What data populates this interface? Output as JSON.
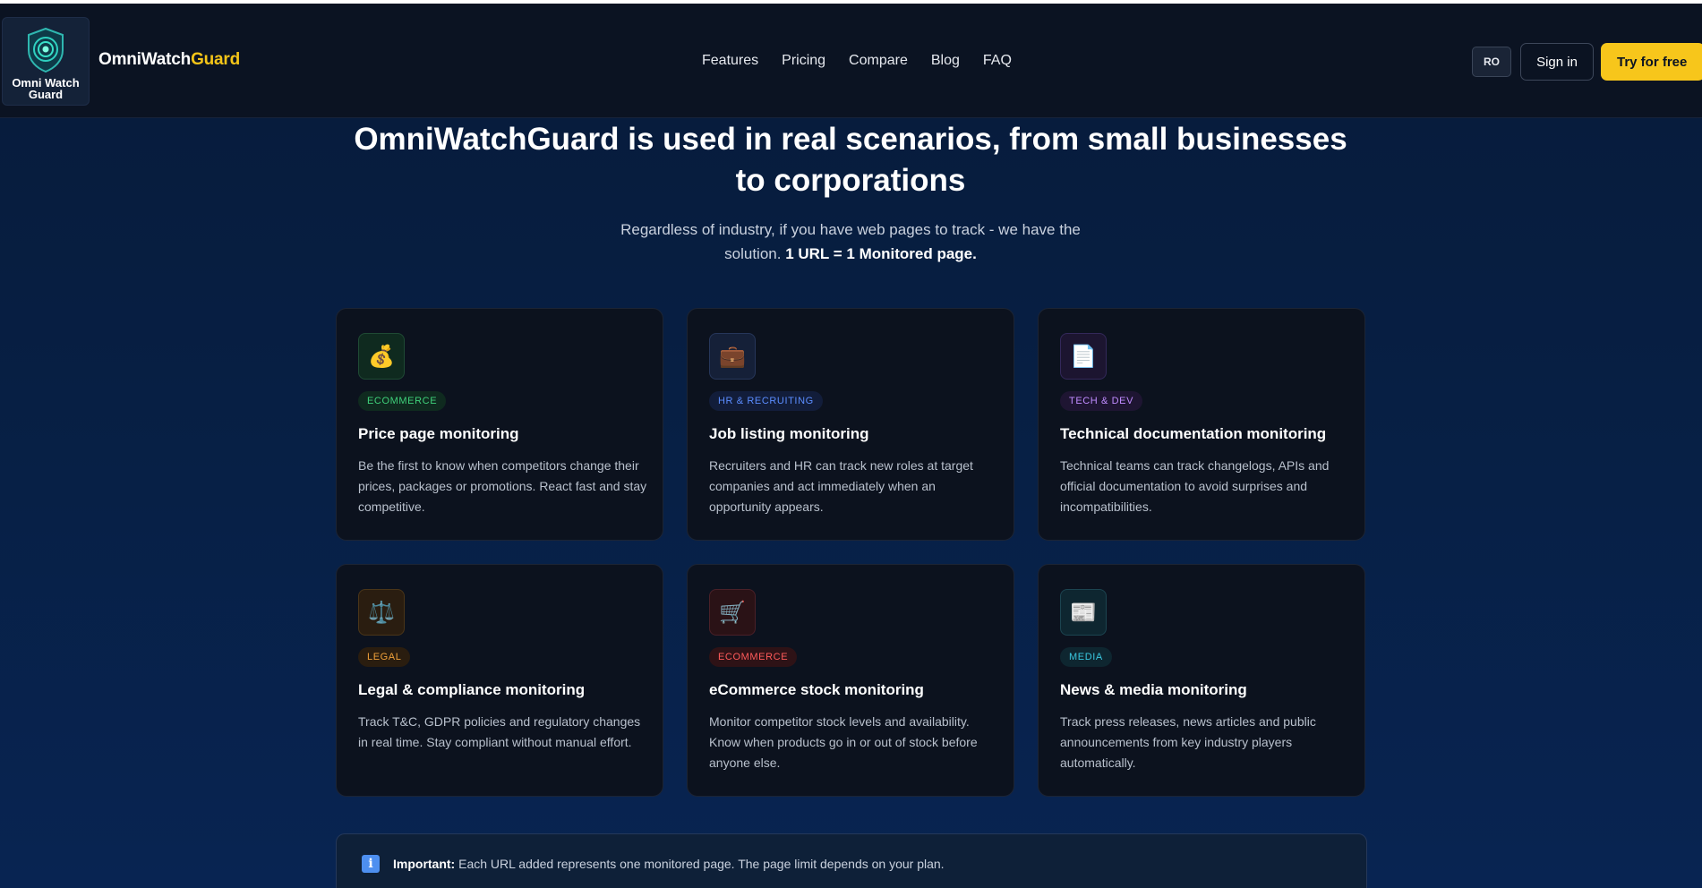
{
  "header": {
    "logo_text_line1": "Omni Watch",
    "logo_text_line2": "Guard",
    "brand_part1": "OmniWatch",
    "brand_part2": "Guard",
    "nav": [
      "Features",
      "Pricing",
      "Compare",
      "Blog",
      "FAQ"
    ],
    "lang": "RO",
    "signin": "Sign in",
    "try": "Try for free"
  },
  "hero": {
    "title_line1": "OmniWatchGuard is used in real scenarios, from small businesses",
    "title_line2": "to corporations",
    "subtitle_line1": "Regardless of industry, if you have web pages to track - we have the",
    "subtitle_line2_plain": "solution.",
    "subtitle_line2_bold": "1 URL = 1 Monitored page."
  },
  "cards": [
    {
      "icon": "money-bag-icon",
      "glyph": "💰",
      "badge": "ECOMMERCE",
      "badge_color": "#3fd07a",
      "badge_bg": "#0f2a1f",
      "icon_bg": "#0f2a1f",
      "icon_border": "#1f4a34",
      "title": "Price page monitoring",
      "desc": "Be the first to know when competitors change their prices, packages or promotions. React fast and stay competitive."
    },
    {
      "icon": "briefcase-icon",
      "glyph": "💼",
      "badge": "HR & RECRUITING",
      "badge_color": "#5b8dff",
      "badge_bg": "#121d3a",
      "icon_bg": "#152038",
      "icon_border": "#26365a",
      "title": "Job listing monitoring",
      "desc": "Recruiters and HR can track new roles at target companies and act immediately when an opportunity appears."
    },
    {
      "icon": "document-icon",
      "glyph": "📄",
      "badge": "TECH & DEV",
      "badge_color": "#c08cff",
      "badge_bg": "#1e1532",
      "icon_bg": "#1c1530",
      "icon_border": "#33285a",
      "title": "Technical documentation monitoring",
      "desc": "Technical teams can track changelogs, APIs and official documentation to avoid surprises and incompatibilities."
    },
    {
      "icon": "scales-icon",
      "glyph": "⚖️",
      "badge": "LEGAL",
      "badge_color": "#f0a13a",
      "badge_bg": "#2a1d0f",
      "icon_bg": "#2a1d10",
      "icon_border": "#4a3518",
      "title": "Legal & compliance monitoring",
      "desc": "Track T&C, GDPR policies and regulatory changes in real time. Stay compliant without manual effort."
    },
    {
      "icon": "shopping-cart-icon",
      "glyph": "🛒",
      "badge": "ECOMMERCE",
      "badge_color": "#ff5a5a",
      "badge_bg": "#2e1216",
      "icon_bg": "#2a1216",
      "icon_border": "#4a2028",
      "title": "eCommerce stock monitoring",
      "desc": "Monitor competitor stock levels and availability. Know when products go in or out of stock before anyone else."
    },
    {
      "icon": "newspaper-icon",
      "glyph": "📰",
      "badge": "MEDIA",
      "badge_color": "#3ac8e0",
      "badge_bg": "#0e2630",
      "icon_bg": "#0e2630",
      "icon_border": "#1c4450",
      "title": "News & media monitoring",
      "desc": "Track press releases, news articles and public announcements from key industry players automatically."
    }
  ],
  "info": {
    "label": "Important:",
    "text": "Each URL added represents one monitored page. The page limit depends on your plan."
  }
}
